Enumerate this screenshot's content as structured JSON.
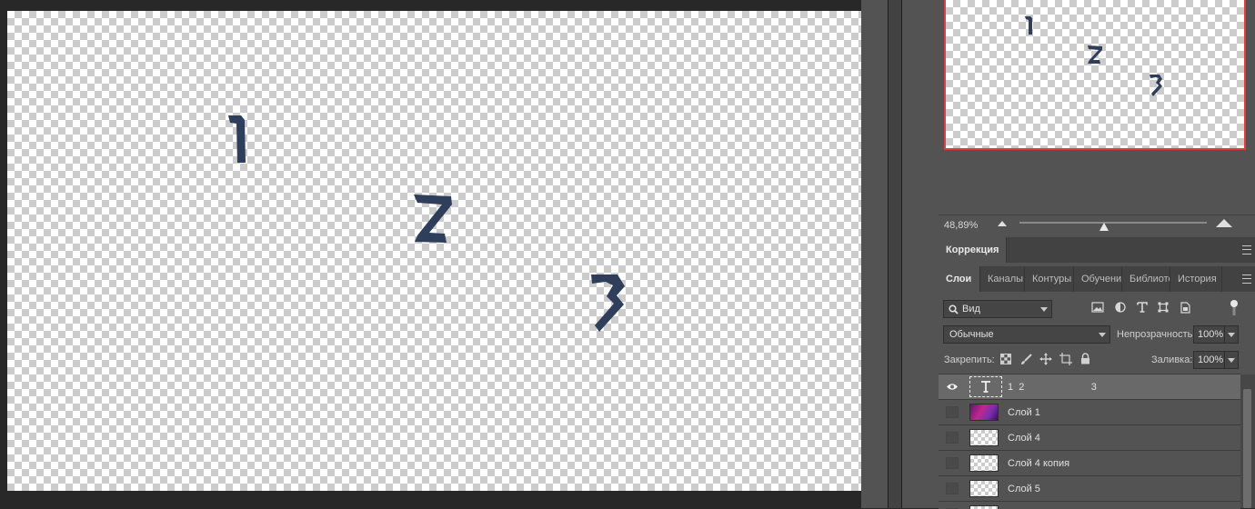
{
  "canvas": {
    "digits": [
      "1",
      "2",
      "3"
    ],
    "digit_color": "#2f3e5a"
  },
  "navigator": {
    "zoom": "48,89%",
    "zoom_slider_value": 0.45,
    "frame_color": "#e03d3d"
  },
  "correction_panel": {
    "tab": "Коррекция"
  },
  "layers_panel": {
    "tabs": [
      "Слои",
      "Каналы",
      "Контуры",
      "Обучение",
      "Библиотеки",
      "История"
    ],
    "active_tab": "Слои",
    "filter": {
      "label": "Вид",
      "icon": "search-icon"
    },
    "filter_icons": [
      "image-filter-icon",
      "adjustment-filter-icon",
      "type-filter-icon",
      "shape-filter-icon",
      "smart-object-filter-icon",
      "filter-toggle-icon"
    ],
    "blend_mode": "Обычные",
    "opacity_label": "Непрозрачность:",
    "opacity_value": "100%",
    "lock_label": "Закрепить:",
    "lock_icons": [
      "lock-transparent-icon",
      "lock-pixels-icon",
      "lock-position-icon",
      "lock-artboard-icon",
      "lock-all-icon"
    ],
    "fill_label": "Заливка:",
    "fill_value": "100%",
    "layers": [
      {
        "name": "1  2                        3",
        "kind": "text",
        "visible": true,
        "selected": true
      },
      {
        "name": "Слой 1",
        "kind": "image",
        "visible": false,
        "selected": false
      },
      {
        "name": "Слой 4",
        "kind": "empty",
        "visible": false,
        "selected": false
      },
      {
        "name": "Слой 4 копия",
        "kind": "empty",
        "visible": false,
        "selected": false
      },
      {
        "name": "Слой 5",
        "kind": "empty",
        "visible": false,
        "selected": false
      }
    ]
  }
}
